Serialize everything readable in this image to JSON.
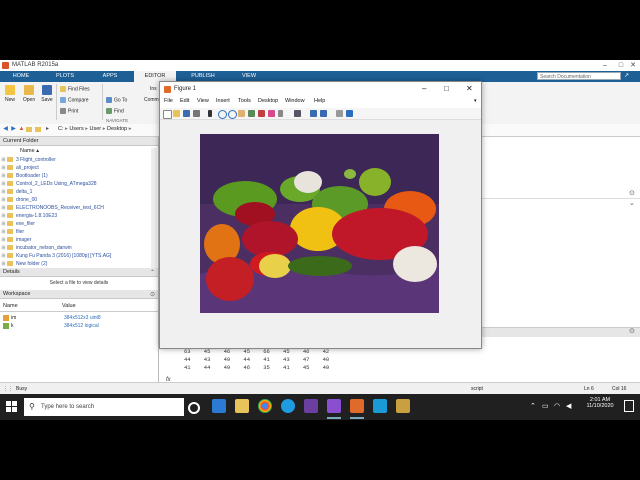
{
  "app": {
    "title": "MATLAB R2015a"
  },
  "ribbon": {
    "tabs": [
      "HOME",
      "PLOTS",
      "APPS",
      "EDITOR",
      "PUBLISH",
      "VIEW"
    ],
    "active_tab": "EDITOR",
    "search_placeholder": "Search Documentation"
  },
  "toolstrip": {
    "new": "New",
    "open": "Open",
    "save": "Save",
    "find_files": "Find Files",
    "compare": "Compare",
    "print": "Print",
    "goto": "Go To",
    "find": "Find",
    "comment": "Comm",
    "navigate": "NAVIGATE",
    "ins": "Ins"
  },
  "addressbar": {
    "path": [
      "C:",
      "Users",
      "User",
      "Desktop"
    ]
  },
  "current_folder": {
    "title": "Current Folder",
    "col_name": "Name",
    "items": [
      "3 Flight_controller",
      "ali_project",
      "Bootloader (1)",
      "Control_2_LEDs Using_ATmega328",
      "delta_1",
      "drone_00",
      "ELECTRONOOBS_Receiver_test_6CH",
      "energia-1.8.10E23",
      "exe_filer",
      "filer",
      "imager",
      "incubator_nelson_darwin",
      "Kung Fu Panda 3 (2016) [1080p] [YTS.AG]",
      "New folder (2)"
    ],
    "details_title": "Details",
    "details_hint": "Select a file to view details"
  },
  "workspace": {
    "title": "Workspace",
    "col_name": "Name",
    "col_value": "Value",
    "rows": [
      {
        "name": "im",
        "value": "384x512x3 uint8"
      },
      {
        "name": "k",
        "value": "384x512 logical"
      }
    ]
  },
  "command_window": {
    "lines": [
      "63    45    46    45    66    45    46    42",
      "44    43    49    44    41    43    47    40",
      "41    44    49    46    35    41    45    49"
    ],
    "prompt": "fx",
    "busy": "Busy"
  },
  "statusbar": {
    "mode": "script",
    "ln": "Ln  6",
    "col": "Col  16"
  },
  "figure": {
    "title": "Figure 1",
    "menus": [
      "File",
      "Edit",
      "View",
      "Insert",
      "Tools",
      "Desktop",
      "Window",
      "Help"
    ]
  },
  "taskbar": {
    "search_placeholder": "Type here to search",
    "time": "2:01 AM",
    "date": "11/10/2020"
  },
  "colors": {
    "ribbon_blue": "#1e5f96",
    "taskbar_bg": "#202020",
    "folder_link": "#2a4fa0"
  }
}
